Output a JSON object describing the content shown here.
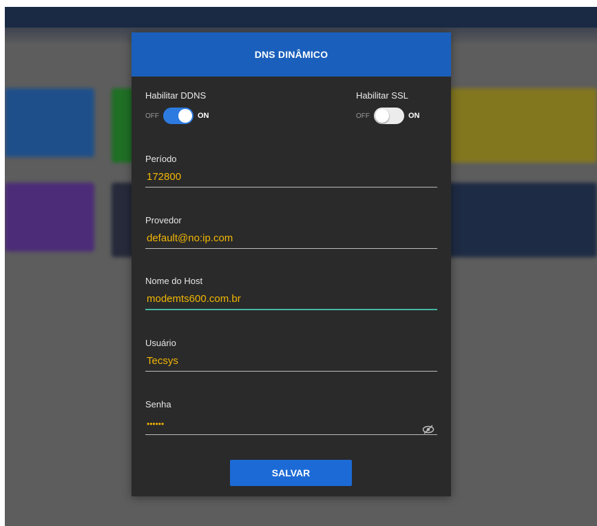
{
  "modal": {
    "title": "DNS DINÂMICO",
    "toggles": [
      {
        "label": "Habilitar DDNS",
        "off_label": "OFF",
        "on_label": "ON",
        "state": "on"
      },
      {
        "label": "Habilitar SSL",
        "off_label": "OFF",
        "on_label": "ON",
        "state": "off"
      }
    ],
    "fields": {
      "periodo": {
        "label": "Período",
        "value": "172800"
      },
      "provedor": {
        "label": "Provedor",
        "value": "default@no:ip.com"
      },
      "host": {
        "label": "Nome do Host",
        "value": "modemts600.com.br"
      },
      "usuario": {
        "label": "Usuário",
        "value": "Tecsys"
      },
      "senha": {
        "label": "Senha",
        "value": "••••••"
      }
    },
    "save_label": "SALVAR"
  },
  "icons": {
    "password_toggle": "eye-off-icon"
  },
  "colors": {
    "header": "#1a5fbb",
    "accent": "#2d7be0",
    "value_text": "#f2b705",
    "focus_underline": "#46b6a4",
    "save_button": "#1c6ad6",
    "modal_bg": "#2a2a2a"
  }
}
